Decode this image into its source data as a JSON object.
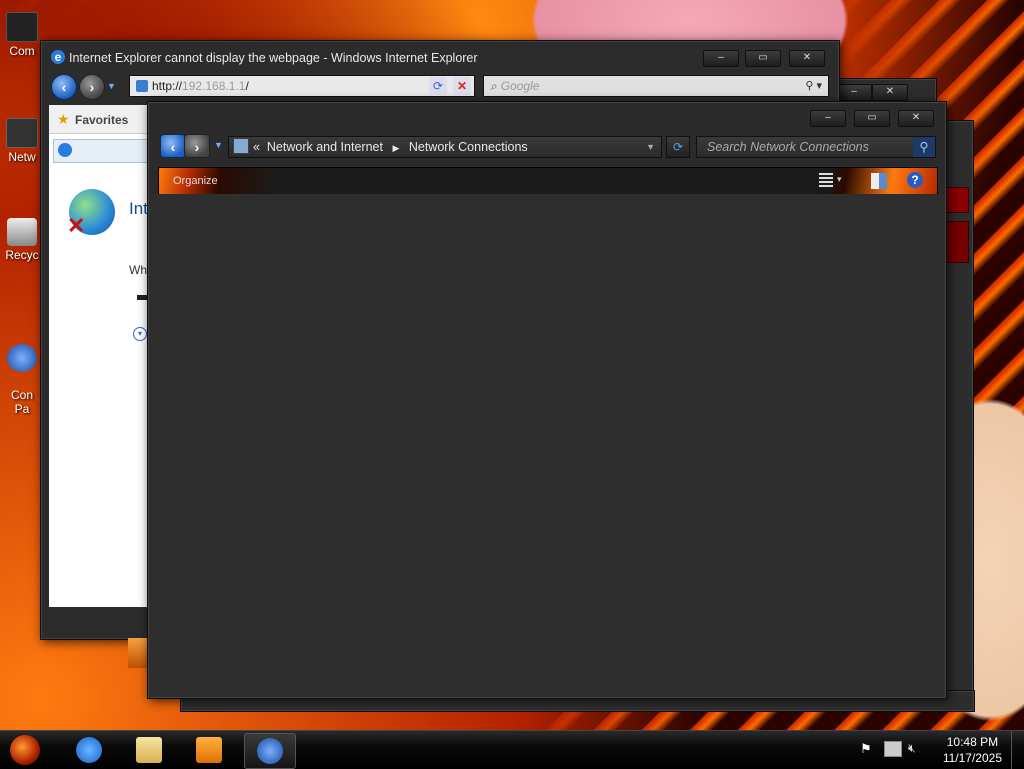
{
  "desktop": {
    "icons": [
      {
        "label": "Com"
      },
      {
        "label": "Netw"
      },
      {
        "label": "Recyc"
      },
      {
        "label": "Con\nPa"
      }
    ]
  },
  "ie_window": {
    "title": "Internet Explorer cannot display the webpage - Windows Internet Explorer",
    "address_prefix": "http://",
    "address_host": "192.168.1.1",
    "address_suffix": "/",
    "search_placeholder": "Google",
    "favorites_label": "Favorites",
    "page_heading_partial": "Int",
    "page_text_partial": "Wh"
  },
  "network_window": {
    "breadcrumb_sep": "«",
    "breadcrumb": [
      "Network and Internet",
      "Network Connections"
    ],
    "search_placeholder": "Search Network Connections",
    "organize_label": "Organize",
    "minimize": "–",
    "maximize": "▭",
    "close": "✕"
  },
  "taskbar": {
    "apps": [
      "start-orb",
      "internet-explorer",
      "windows-explorer",
      "media-player",
      "network-app"
    ],
    "time": "10:48 PM",
    "date": "11/17/2025"
  }
}
